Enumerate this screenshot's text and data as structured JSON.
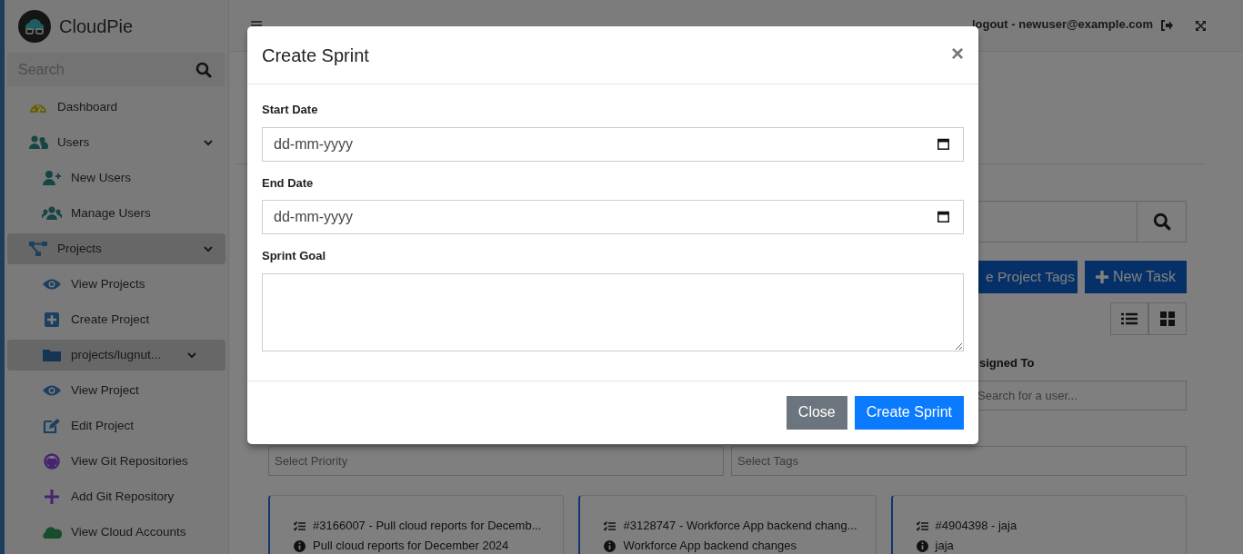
{
  "sidebar": {
    "brand": "CloudPie",
    "search": {
      "placeholder": "Search"
    },
    "items": [
      {
        "label": "Dashboard",
        "selected": false
      },
      {
        "label": "Users",
        "expanded": true,
        "selected": false,
        "children": [
          {
            "label": "New Users",
            "selected": false
          },
          {
            "label": "Manage Users",
            "selected": false
          }
        ]
      },
      {
        "label": "Projects",
        "expanded": true,
        "selected": true,
        "children": [
          {
            "label": "View Projects",
            "selected": false
          },
          {
            "label": "Create Project",
            "selected": false
          },
          {
            "label": "projects/lugnut...",
            "expanded": true,
            "selected": true,
            "children": [
              {
                "label": "View Project",
                "selected": false
              },
              {
                "label": "Edit Project",
                "selected": false
              },
              {
                "label": "View Git Repositories",
                "selected": false
              },
              {
                "label": "Add Git Repository",
                "selected": false
              },
              {
                "label": "View Cloud Accounts",
                "selected": false
              }
            ]
          }
        ]
      }
    ]
  },
  "topbar": {
    "user_link": "logout - newuser@example.com"
  },
  "main": {
    "buttons": [
      {
        "label": "e Project Tags",
        "kind": "tags"
      },
      {
        "label": "New Task",
        "kind": "new"
      }
    ],
    "view_toggle": [
      {
        "kind": "list"
      },
      {
        "kind": "grid"
      }
    ],
    "filters": {
      "assignee_label": "signed To",
      "assignee_placeholder": "Search for a user...",
      "priority_placeholder": "Select Priority",
      "tags_placeholder": "Select Tags"
    },
    "tasks": [
      {
        "title": "#3166007 - Pull cloud reports for Decemb...",
        "description": "Pull cloud reports for December 2024"
      },
      {
        "title": "#3128747 - Workforce App backend chang...",
        "description": "Workforce App backend changes"
      },
      {
        "title": "#4904398 - jaja",
        "description": "jaja"
      }
    ]
  },
  "modal": {
    "title": "Create Sprint",
    "close_glyph": "×",
    "fields": [
      {
        "label": "Start Date",
        "kind": "date",
        "placeholder": "dd-mm-yyyy"
      },
      {
        "label": "End Date",
        "kind": "date",
        "placeholder": "dd-mm-yyyy"
      },
      {
        "label": "Sprint Goal",
        "kind": "textarea"
      }
    ],
    "buttons": [
      {
        "label": "Close",
        "kind": "secondary"
      },
      {
        "label": "Create Sprint",
        "kind": "primary"
      }
    ]
  }
}
